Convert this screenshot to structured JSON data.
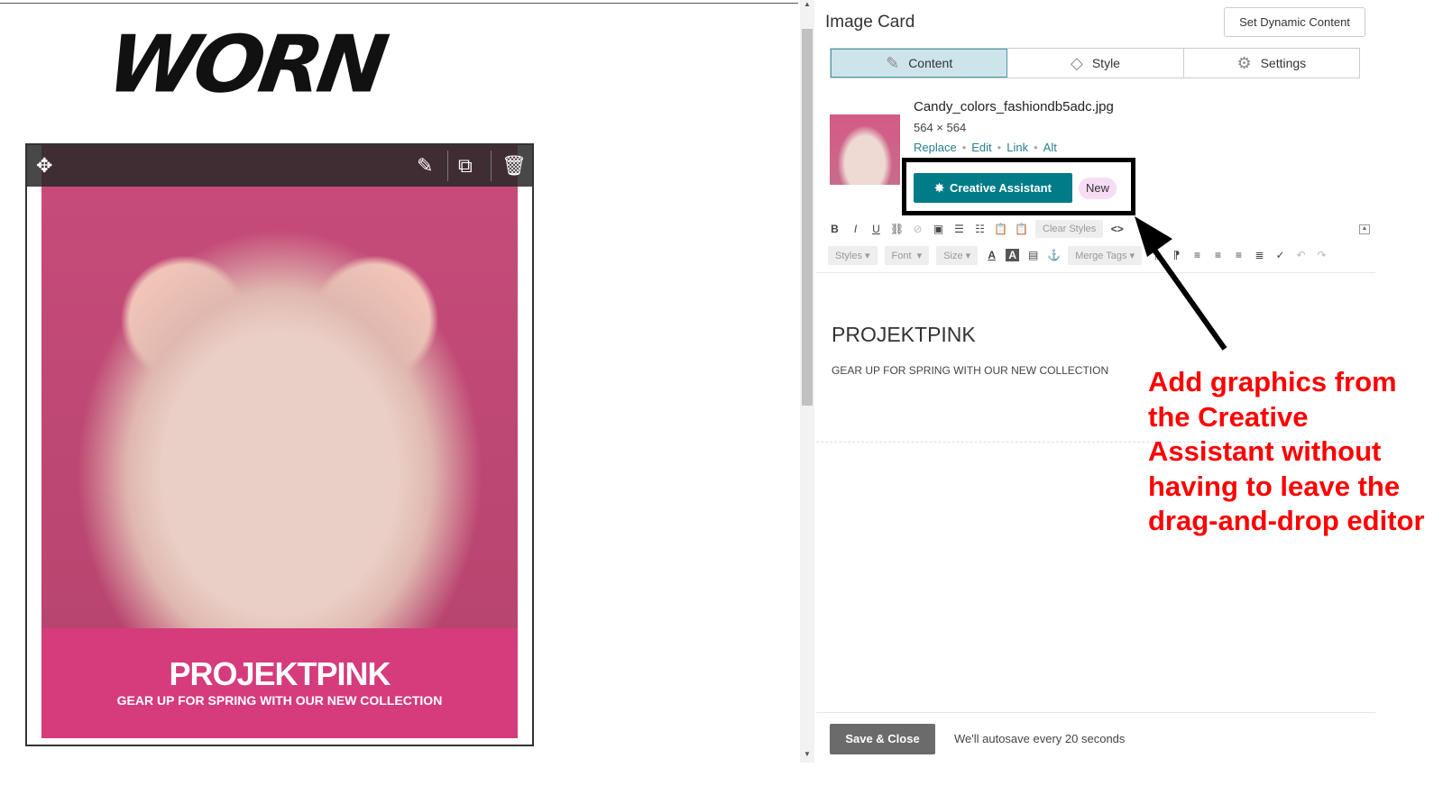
{
  "canvas": {
    "logo": "WORN",
    "card": {
      "heading": "PROJEKTPINK",
      "subheading": "GEAR UP FOR SPRING WITH OUR NEW COLLECTION"
    }
  },
  "panel": {
    "title": "Image Card",
    "dynamic_button": "Set Dynamic Content",
    "tabs": [
      {
        "label": "Content",
        "icon": "edit-list-icon",
        "active": true
      },
      {
        "label": "Style",
        "icon": "paint-bucket-icon"
      },
      {
        "label": "Settings",
        "icon": "gear-icon"
      }
    ],
    "image": {
      "filename": "Candy_colors_fashiondb5adc.jpg",
      "dimensions": "564 × 564",
      "links": [
        "Replace",
        "Edit",
        "Link",
        "Alt"
      ]
    },
    "creative_assistant": {
      "label": "Creative Assistant",
      "badge": "New"
    },
    "toolbar": {
      "clear_styles": "Clear Styles",
      "styles": "Styles",
      "font": "Font",
      "size": "Size",
      "merge_tags": "Merge Tags"
    },
    "editor": {
      "heading": "PROJEKTPINK",
      "body": "GEAR UP FOR SPRING WITH OUR NEW COLLECTION"
    },
    "footer": {
      "save": "Save & Close",
      "autosave": "We'll autosave every 20 seconds"
    }
  },
  "annotation": {
    "text": "Add graphics from the Creative Assistant without having to leave the drag-and-drop editor",
    "color": "#ff0000"
  },
  "colors": {
    "accent": "#007c89",
    "banner": "#d63b7c"
  }
}
